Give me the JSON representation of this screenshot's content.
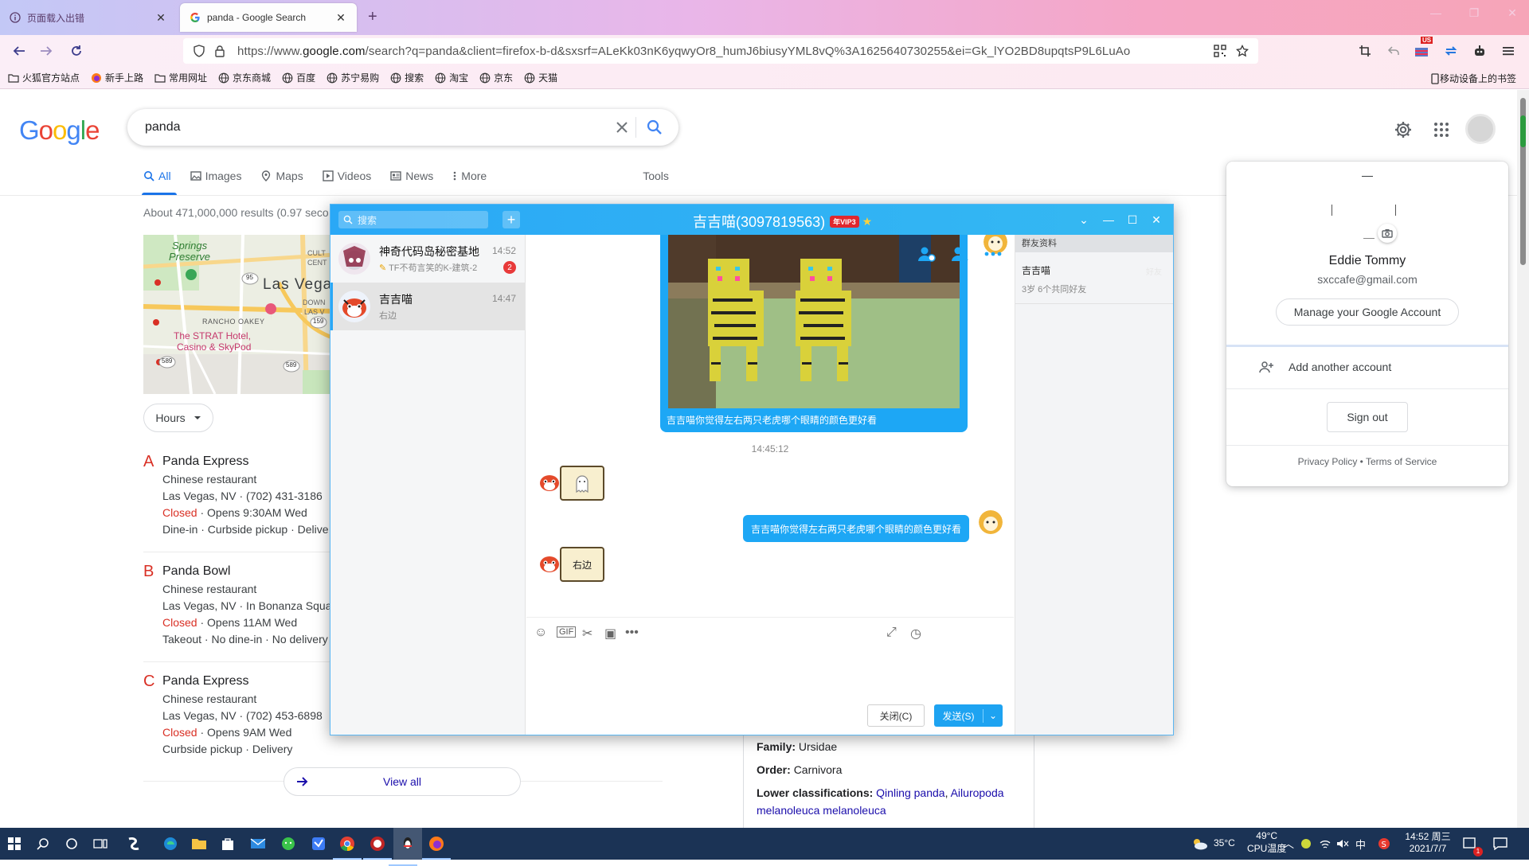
{
  "browser": {
    "tabs": [
      {
        "label": "页面载入出错",
        "active": false
      },
      {
        "label": "panda - Google Search",
        "active": true
      }
    ],
    "url_prefix": "https://www.",
    "url_host": "google.com",
    "url_rest": "/search?q=panda&client=firefox-b-d&sxsrf=ALeKk03nK6yqwyOr8_humJ6biusyYML8vQ%3A1625640730255&ei=Gk_lYO2BD8upqtsP9L6LuAo",
    "ext_badge": "US",
    "bookmarks": [
      "火狐官方站点",
      "新手上路",
      "常用网址",
      "京东商城",
      "百度",
      "苏宁易购",
      "搜索",
      "淘宝",
      "京东",
      "天猫"
    ],
    "mobile_bookmarks": "移动设备上的书签"
  },
  "google": {
    "logo": "Google",
    "query": "panda",
    "nav": [
      {
        "label": "All",
        "icon": "search-icon"
      },
      {
        "label": "Images",
        "icon": "image-icon"
      },
      {
        "label": "Maps",
        "icon": "map-pin-icon"
      },
      {
        "label": "Videos",
        "icon": "play-icon"
      },
      {
        "label": "News",
        "icon": "news-icon"
      },
      {
        "label": "More",
        "icon": "more-vert-icon"
      }
    ],
    "tools": "Tools",
    "results_count": "About 471,000,000 results (0.97 seco",
    "map_labels": {
      "springs1": "Springs",
      "springs2": "Preserve",
      "city": "Las Vega",
      "cult": "CULT",
      "cent": "CENT",
      "down": "DOWN",
      "lasv": "LAS V",
      "rancho": "RANCHO OAKEY",
      "strat1": "The STRAT Hotel,",
      "strat2": "Casino & SkyPod",
      "hw95": "95",
      "hw159": "159",
      "hw589a": "589",
      "hw589b": "589"
    },
    "hours_btn": "Hours",
    "places": [
      {
        "letter": "A",
        "name": "Panda Express",
        "type": "Chinese restaurant",
        "addr": "Las Vegas, NV · (702) 431-3186",
        "status": "Closed",
        "opens": " · Opens 9:30AM Wed",
        "services": "Dine-in · Curbside pickup · Delive"
      },
      {
        "letter": "B",
        "name": "Panda Bowl",
        "type": "Chinese restaurant",
        "addr": "Las Vegas, NV · In Bonanza Squa",
        "status": "Closed",
        "opens": " · Opens 11AM Wed",
        "services": "Takeout · No dine-in · No delivery"
      },
      {
        "letter": "C",
        "name": "Panda Express",
        "type": "Chinese restaurant",
        "addr": "Las Vegas, NV · (702) 453-6898",
        "status": "Closed",
        "opens": " · Opens 9AM Wed",
        "services": "Curbside pickup · Delivery"
      }
    ],
    "view_all": "View all",
    "kp": {
      "family_label": "Family:",
      "family": "Ursidae",
      "order_label": "Order:",
      "order": "Carnivora",
      "lower_label": "Lower classifications:",
      "lower1": "Qinling panda",
      "lower_sep": ", ",
      "lower2": "Ailuropoda melanoleuca melanoleuca"
    }
  },
  "account": {
    "name": "Eddie Tommy",
    "email": "sxccafe@gmail.com",
    "manage": "Manage your Google Account",
    "add": "Add another account",
    "signout": "Sign out",
    "footer": "Privacy Policy  •  Terms of Service"
  },
  "qq": {
    "search_placeholder": "搜索",
    "title": "吉吉喵(3097819563)",
    "vip": "年VIP3",
    "conversations": [
      {
        "title": "神奇代码岛秘密基地",
        "time": "14:52",
        "sub": "TF不苟言笑的K-建筑-2",
        "badge": "2"
      },
      {
        "title": "吉吉喵",
        "time": "14:47",
        "sub": "右边",
        "badge": ""
      }
    ],
    "image_caption": "吉吉喵你觉得左右两只老虎哪个眼睛的颜色更好看",
    "timestamp": "14:45:12",
    "my_message": "吉吉喵你觉得左右两只老虎哪个眼睛的颜色更好看",
    "reply_sticker": "右边",
    "close_btn": "关闭(C)",
    "send_btn": "发送(S)",
    "side_header": "群友资料",
    "side_name": "吉吉喵",
    "side_sub": "3岁 6个共同好友",
    "side_extra": "好友"
  },
  "taskbar": {
    "temp": "35°C",
    "cpu_temp": "49°C",
    "cpu_label": "CPU温度",
    "ime": "中",
    "time": "14:52 周三",
    "date": "2021/7/7",
    "notif_count": "1"
  }
}
